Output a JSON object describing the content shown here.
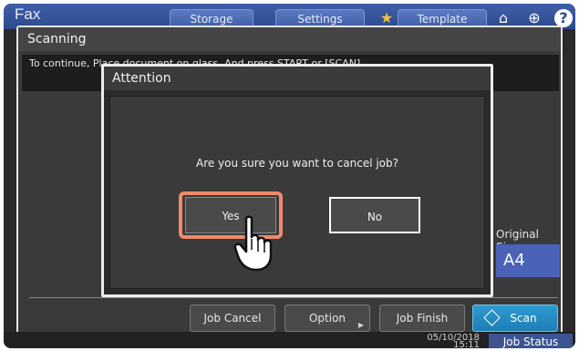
{
  "app": {
    "title": "Fax",
    "top_tabs": [
      "Storage",
      "Settings",
      "Template"
    ],
    "top_icons": [
      "star-icon",
      "home-icon",
      "globe-icon",
      "help-icon"
    ]
  },
  "scanning": {
    "title": "Scanning",
    "message": "To continue, Place document on glass. And press START or [SCAN].",
    "original_size_label": "Original Size",
    "original_size_value": "A4",
    "buttons": {
      "job_cancel": "Job Cancel",
      "option": "Option",
      "job_finish": "Job Finish",
      "scan": "Scan"
    }
  },
  "status": {
    "time_line1": "05/10/2018",
    "time_line2": "15:11",
    "job_status": "Job Status"
  },
  "attention": {
    "title": "Attention",
    "message": "Are you sure you want to cancel job?",
    "yes": "Yes",
    "no": "No"
  },
  "colors": {
    "highlight": "#f08a6b",
    "scan_button": "#2e9bd1",
    "size_box": "#4a63b8",
    "top_bar": "#3f5fa8"
  },
  "icons": {
    "pointer": "hand-pointer-icon",
    "scan": "diamond-icon"
  }
}
